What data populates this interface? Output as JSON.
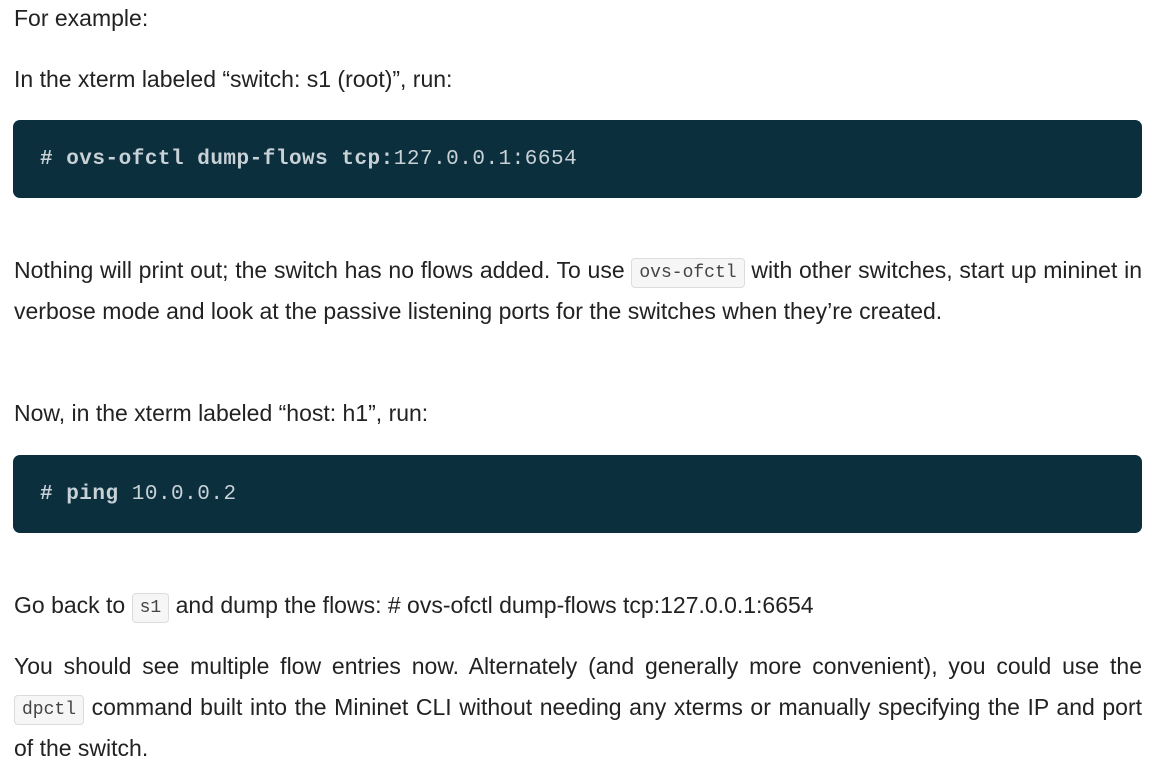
{
  "para1": "For example:",
  "para2": "In the xterm labeled “switch: s1 (root)”, run:",
  "code1": {
    "prompt": "# ovs-ofctl dump-flows tcp:",
    "addr": "127.0.0.1:6654"
  },
  "para3": {
    "before": "Nothing will print out; the switch has no flows added. To use",
    "code": "ovs-ofctl",
    "after": "with other switches, start up mininet in verbose mode and look at the passive listening ports for the switches when they’re created."
  },
  "para4": "Now, in the xterm labeled “host: h1”, run:",
  "code2": {
    "prompt": "# ping",
    "addr": "10.0.0.2"
  },
  "para5": {
    "before": "Go back to",
    "code": "s1",
    "after": "and dump the flows: # ovs-ofctl dump-flows tcp:127.0.0.1:6654"
  },
  "para6": {
    "before": "You should see multiple flow entries now. Alternately (and generally more convenient), you could use the",
    "code": "dpctl",
    "after": "command built into the Mininet CLI without needing any xterms or manually specifying the IP and port of the switch."
  }
}
